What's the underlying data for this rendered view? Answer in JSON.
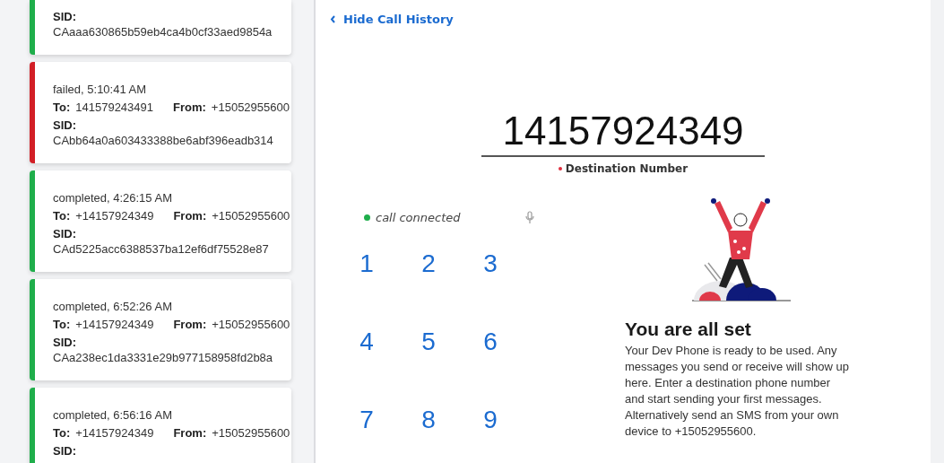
{
  "call_history": [
    {
      "sid_label": "SID:",
      "sid": "CAaaa630865b59eb4ca4b0cf33aed9854a",
      "color": "#1fae4b"
    },
    {
      "status": "failed, 5:10:41 AM",
      "to_label": "To:",
      "to": "141579243491",
      "from_label": "From:",
      "from": "+15052955600",
      "sid_label": "SID:",
      "sid": "CAbb64a0a603433388be6abf396eadb314",
      "color": "#d21f26"
    },
    {
      "status": "completed, 4:26:15 AM",
      "to_label": "To:",
      "to": "+14157924349",
      "from_label": "From:",
      "from": "+15052955600",
      "sid_label": "SID:",
      "sid": "CAd5225acc6388537ba12ef6df75528e87",
      "color": "#1fae4b"
    },
    {
      "status": "completed, 6:52:26 AM",
      "to_label": "To:",
      "to": "+14157924349",
      "from_label": "From:",
      "from": "+15052955600",
      "sid_label": "SID:",
      "sid": "CAa238ec1da3331e29b977158958fd2b8a",
      "color": "#1fae4b"
    },
    {
      "status": "completed, 6:56:16 AM",
      "to_label": "To:",
      "to": "+14157924349",
      "from_label": "From:",
      "from": "+15052955600",
      "sid_label": "SID:",
      "color": "#1fae4b"
    }
  ],
  "hide_history_link": "Hide Call History",
  "destination": {
    "value": "14157924349",
    "label": "Destination Number",
    "required": true
  },
  "call_status": {
    "text": "call connected",
    "color": "#1fae4b"
  },
  "keypad": [
    "1",
    "2",
    "3",
    "4",
    "5",
    "6",
    "7",
    "8",
    "9"
  ],
  "empty_state": {
    "title": "You are all set",
    "text": "Your Dev Phone is ready to be used. Any messages you send or receive will show up here. Enter a destination phone number and start sending your first messages. Alternatively send an SMS from your own device to +15052955600."
  }
}
